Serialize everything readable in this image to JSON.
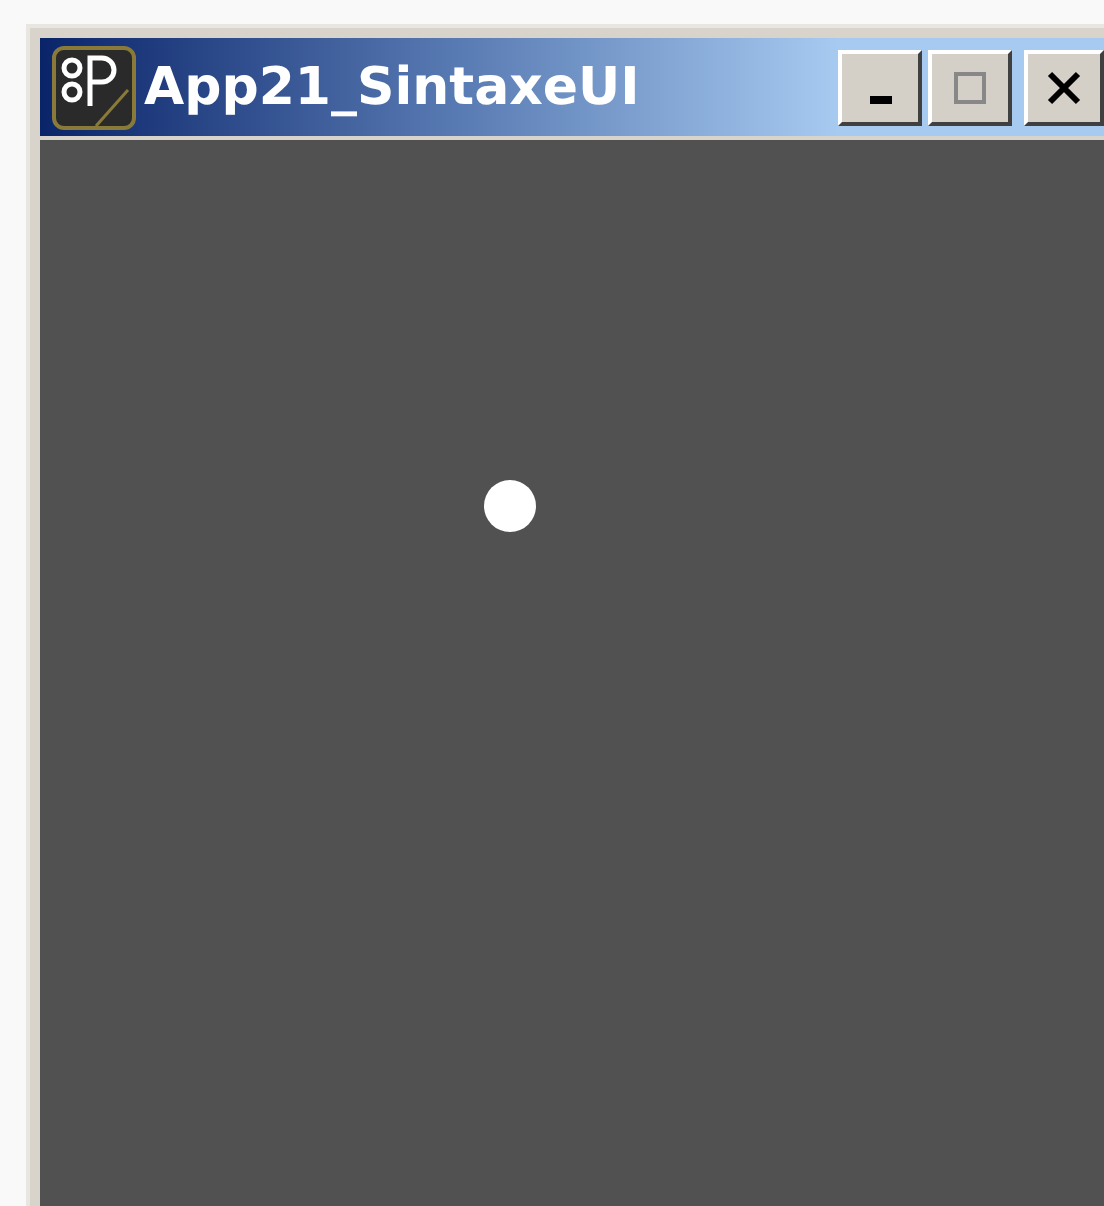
{
  "window": {
    "title": "App21_SintaxeUI"
  }
}
